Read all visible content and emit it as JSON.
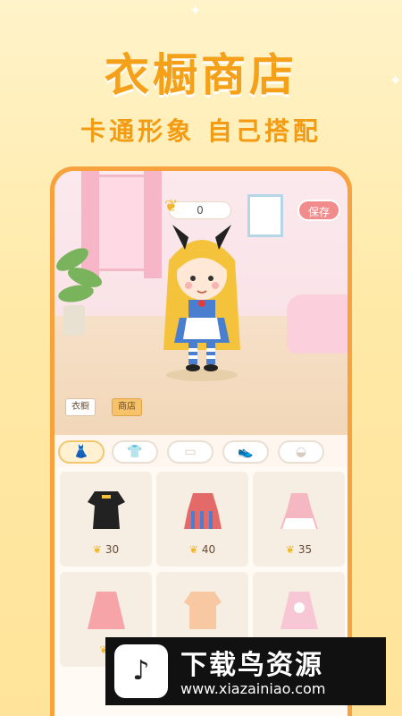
{
  "header": {
    "title": "衣橱商店",
    "subtitle": "卡通形象 自己搭配"
  },
  "app": {
    "coins": "0",
    "save_label": "保存",
    "tabs": [
      "衣橱",
      "商店"
    ],
    "categories": [
      "dress-icon",
      "shirt-icon",
      "skirt-icon",
      "shoes-icon",
      "hair-icon"
    ],
    "items": [
      {
        "price": "30",
        "color": "#222222"
      },
      {
        "price": "40",
        "color": "#e46a6a"
      },
      {
        "price": "35",
        "color": "#f5b8c2"
      },
      {
        "price": "",
        "color": "#f7a4a8"
      },
      {
        "price": "",
        "color": "#f7c8a2"
      },
      {
        "price": "",
        "color": "#f7c7d5"
      }
    ]
  },
  "footer": {
    "site_name": "下载鸟资源",
    "site_url": "www.xiazainiao.com"
  },
  "colors": {
    "accent": "#f5a019",
    "phone_frame": "#f7a23d",
    "save_button": "#f28c8c"
  }
}
